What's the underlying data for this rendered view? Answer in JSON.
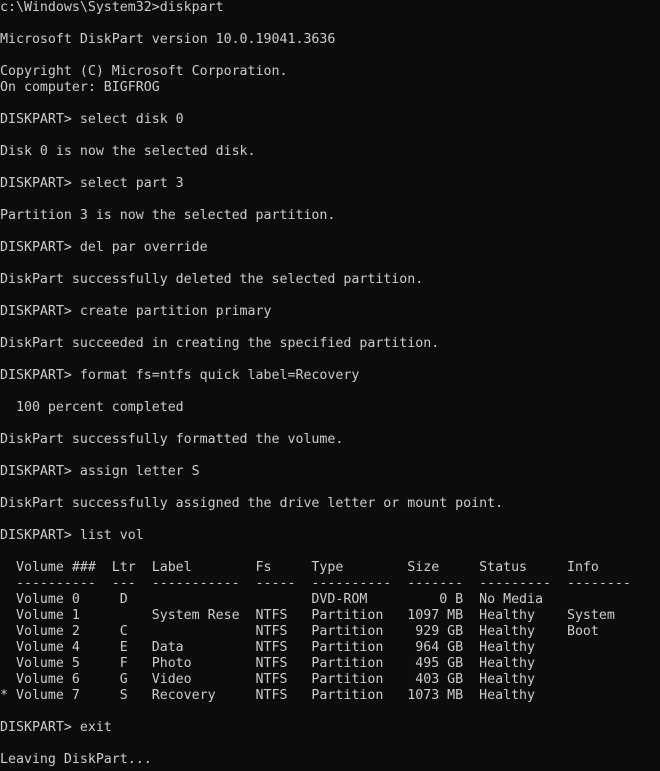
{
  "window": {
    "background_color": "#0c0c0c",
    "text_color": "#cccccc"
  },
  "console": {
    "lines": [
      "c:\\Windows\\System32>diskpart",
      "",
      "Microsoft DiskPart version 10.0.19041.3636",
      "",
      "Copyright (C) Microsoft Corporation.",
      "On computer: BIGFROG",
      "",
      "DISKPART> select disk 0",
      "",
      "Disk 0 is now the selected disk.",
      "",
      "DISKPART> select part 3",
      "",
      "Partition 3 is now the selected partition.",
      "",
      "DISKPART> del par override",
      "",
      "DiskPart successfully deleted the selected partition.",
      "",
      "DISKPART> create partition primary",
      "",
      "DiskPart succeeded in creating the specified partition.",
      "",
      "DISKPART> format fs=ntfs quick label=Recovery",
      "",
      "  100 percent completed",
      "",
      "DiskPart successfully formatted the volume.",
      "",
      "DISKPART> assign letter S",
      "",
      "DiskPart successfully assigned the drive letter or mount point.",
      "",
      "DISKPART> list vol",
      "",
      "  Volume ###  Ltr  Label        Fs     Type        Size     Status     Info",
      "  ----------  ---  -----------  -----  ----------  -------  ---------  --------",
      "  Volume 0     D                       DVD-ROM         0 B  No Media",
      "  Volume 1         System Rese  NTFS   Partition   1097 MB  Healthy    System",
      "  Volume 2     C                NTFS   Partition    929 GB  Healthy    Boot",
      "  Volume 4     E   Data         NTFS   Partition    964 GB  Healthy",
      "  Volume 5     F   Photo        NTFS   Partition    495 GB  Healthy",
      "  Volume 6     G   Video        NTFS   Partition    403 GB  Healthy",
      "* Volume 7     S   Recovery     NTFS   Partition   1073 MB  Healthy",
      "",
      "DISKPART> exit",
      "",
      "Leaving DiskPart..."
    ]
  }
}
